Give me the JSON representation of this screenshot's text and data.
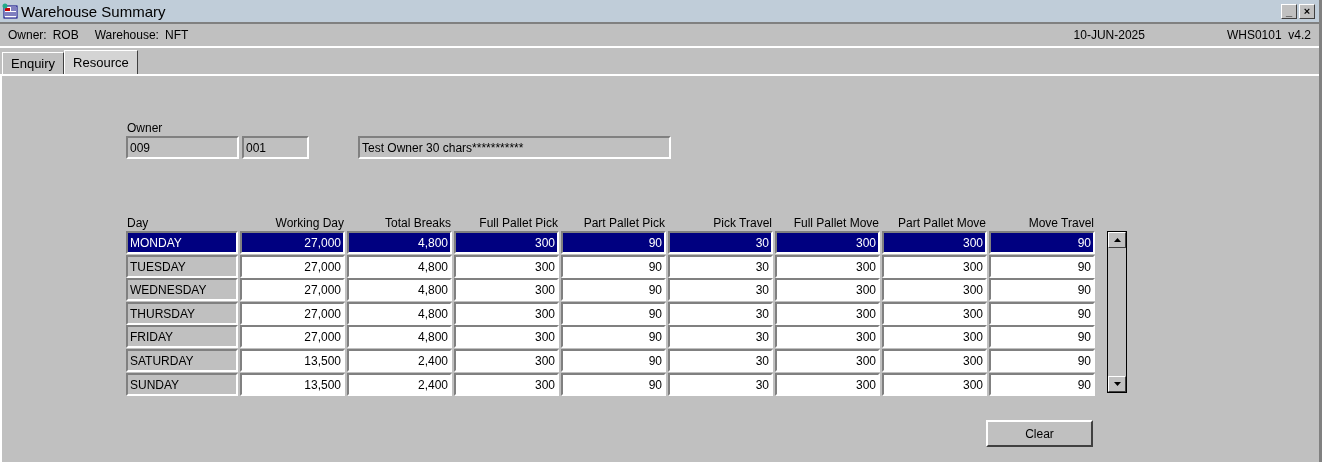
{
  "window": {
    "title": "Warehouse Summary",
    "controls": [
      "_",
      "×"
    ]
  },
  "info_bar": {
    "owner_label": "Owner:",
    "owner": "ROB",
    "warehouse_label": "Warehouse:",
    "warehouse": "NFT",
    "date": "10-JUN-2025",
    "program": "WHS0101  v4.2"
  },
  "tabs": [
    {
      "label": "Enquiry",
      "selected": false
    },
    {
      "label": "Resource",
      "selected": true
    }
  ],
  "owner": {
    "label": "Owner",
    "code": "009",
    "sub_code": "001",
    "name": "Test Owner 30 chars***********"
  },
  "table": {
    "columns": [
      "Day",
      "Working Day",
      "Total Breaks",
      "Full Pallet Pick",
      "Part Pallet Pick",
      "Pick Travel",
      "Full Pallet Move",
      "Part Pallet Move",
      "Move Travel"
    ],
    "rows": [
      {
        "selected": true,
        "cells": [
          "MONDAY",
          "27,000",
          "4,800",
          "300",
          "90",
          "30",
          "300",
          "300",
          "90"
        ]
      },
      {
        "selected": false,
        "cells": [
          "TUESDAY",
          "27,000",
          "4,800",
          "300",
          "90",
          "30",
          "300",
          "300",
          "90"
        ]
      },
      {
        "selected": false,
        "cells": [
          "WEDNESDAY",
          "27,000",
          "4,800",
          "300",
          "90",
          "30",
          "300",
          "300",
          "90"
        ]
      },
      {
        "selected": false,
        "cells": [
          "THURSDAY",
          "27,000",
          "4,800",
          "300",
          "90",
          "30",
          "300",
          "300",
          "90"
        ]
      },
      {
        "selected": false,
        "cells": [
          "FRIDAY",
          "27,000",
          "4,800",
          "300",
          "90",
          "30",
          "300",
          "300",
          "90"
        ]
      },
      {
        "selected": false,
        "cells": [
          "SATURDAY",
          "13,500",
          "2,400",
          "300",
          "90",
          "30",
          "300",
          "300",
          "90"
        ]
      },
      {
        "selected": false,
        "cells": [
          "SUNDAY",
          "13,500",
          "2,400",
          "300",
          "90",
          "30",
          "300",
          "300",
          "90"
        ]
      }
    ]
  },
  "buttons": [
    "Clear"
  ]
}
